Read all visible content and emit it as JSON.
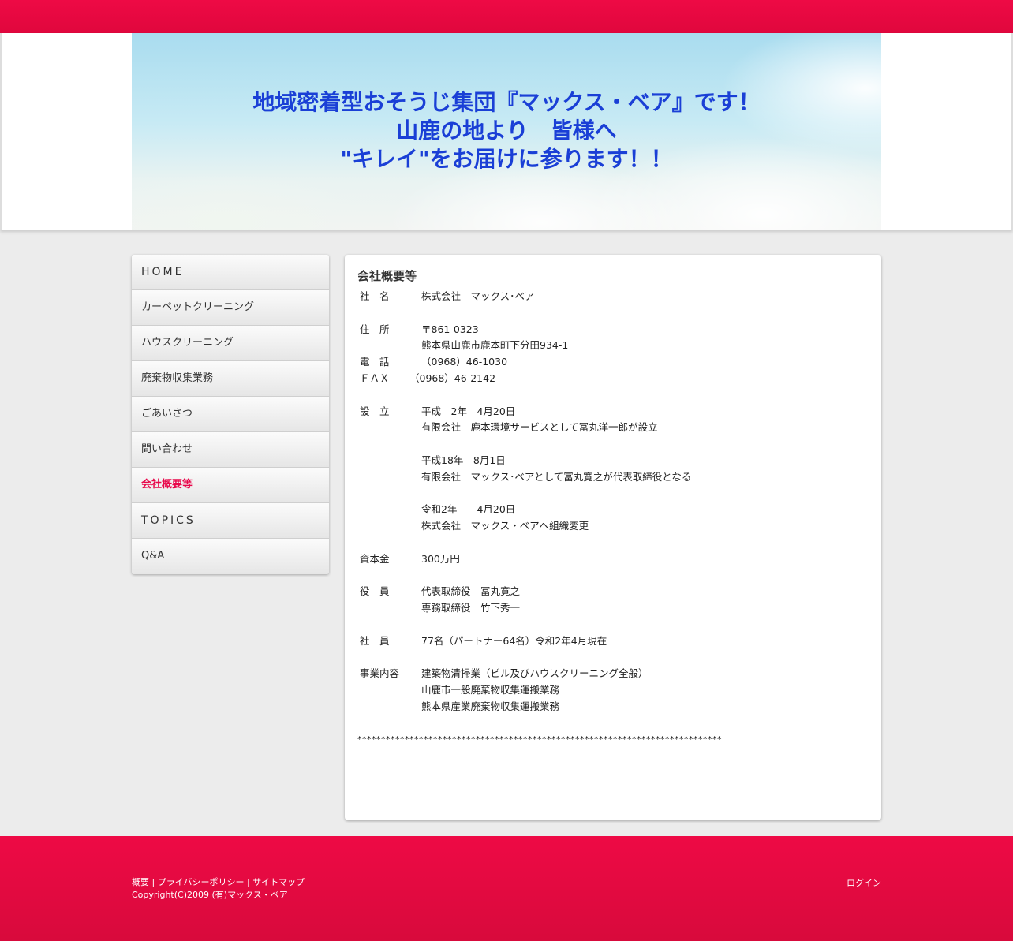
{
  "header": {
    "lines": [
      "地域密着型おそうじ集団『マックス・ベア』です！",
      "山鹿の地より　皆様へ",
      "\"キレイ\"をお届けに参ります！！"
    ]
  },
  "nav": [
    {
      "label": "HOME",
      "caps": true
    },
    {
      "label": "カーペットクリーニング"
    },
    {
      "label": "ハウスクリーニング"
    },
    {
      "label": "廃棄物収集業務"
    },
    {
      "label": "ごあいさつ"
    },
    {
      "label": "問い合わせ"
    },
    {
      "label": "会社概要等",
      "active": true
    },
    {
      "label": "TOPICS",
      "caps": true
    },
    {
      "label": "Q&A"
    }
  ],
  "content": {
    "title": "会社概要等",
    "rows": [
      {
        "k": "社　名",
        "v": "株式会社　マックス･ベア"
      },
      {
        "blank": true
      },
      {
        "k": "住　所",
        "v": "〒861-0323"
      },
      {
        "k": "",
        "v": "熊本県山鹿市鹿本町下分田934-1"
      },
      {
        "k": "電　話",
        "v": "（0968）46-1030"
      },
      {
        "k": "ＦＡＸ",
        "v": "（0968）46-2142",
        "fax": true
      },
      {
        "blank": true
      },
      {
        "k": "設　立",
        "v": "平成　2年　4月20日"
      },
      {
        "k": "",
        "v": "有限会社　鹿本環境サービスとして冨丸洋一郎が設立"
      },
      {
        "blank": true
      },
      {
        "k": "",
        "v": "平成18年　8月1日"
      },
      {
        "k": "",
        "v": "有限会社　マックス･ベアとして冨丸寛之が代表取締役となる"
      },
      {
        "blank": true
      },
      {
        "k": "",
        "v": "令和2年　　4月20日"
      },
      {
        "k": "",
        "v": "株式会社　マックス・ベアへ組織変更"
      },
      {
        "blank": true
      },
      {
        "k": "資本金",
        "v": "300万円"
      },
      {
        "blank": true
      },
      {
        "k": "役　員",
        "v": "代表取締役　冨丸寛之"
      },
      {
        "k": "",
        "v": "専務取締役　竹下秀一"
      },
      {
        "blank": true
      },
      {
        "k": "社　員",
        "v": "77名（パートナー64名）令和2年4月現在"
      },
      {
        "blank": true
      },
      {
        "k": "事業内容",
        "v": "建築物清掃業（ビル及びハウスクリーニング全般）"
      },
      {
        "k": "",
        "v": "山鹿市一般廃棄物収集運搬業務"
      },
      {
        "k": "",
        "v": "熊本県産業廃棄物収集運搬業務"
      },
      {
        "blank": true
      },
      {
        "stars": "*****************************************************************************"
      }
    ]
  },
  "footer": {
    "link_overview": "概要",
    "link_privacy": "プライバシーポリシー",
    "link_sitemap": "サイトマップ",
    "separator": " | ",
    "copyright": "Copyright(C)2009 (有)マックス・ベア",
    "login": "ログイン"
  }
}
